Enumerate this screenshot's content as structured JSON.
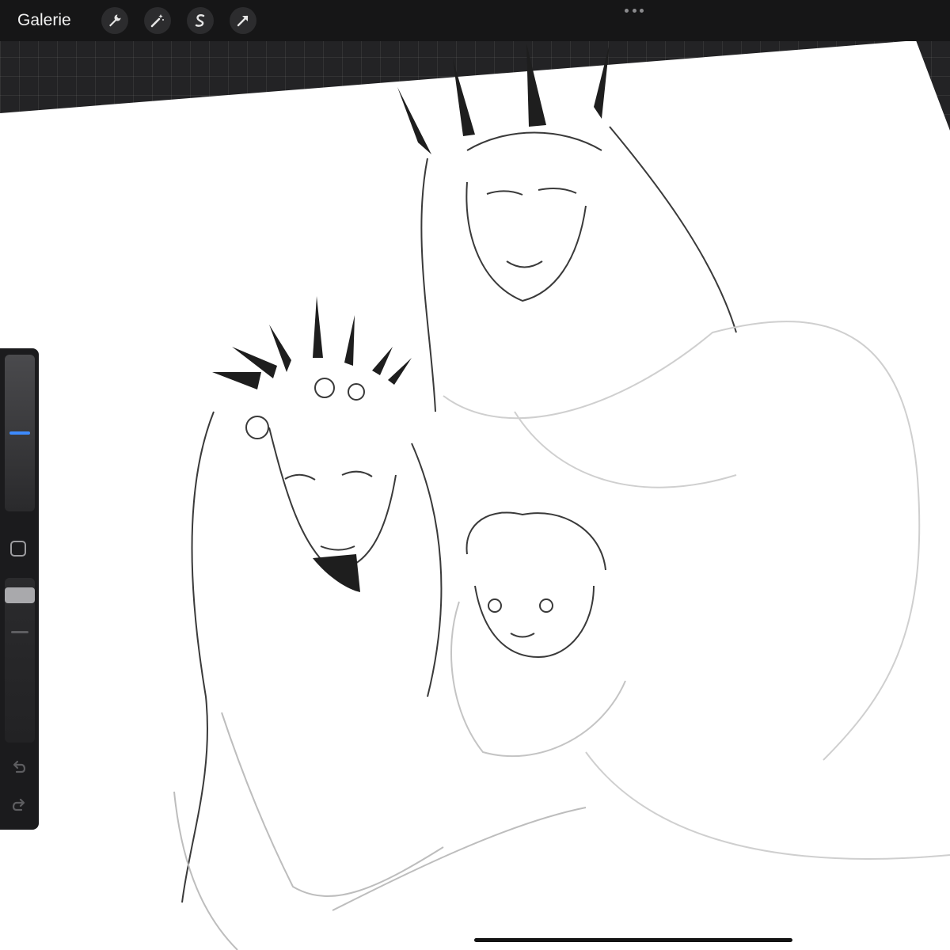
{
  "toolbar": {
    "gallery_label": "Galerie",
    "tools": [
      {
        "name": "actions",
        "icon": "wrench-icon"
      },
      {
        "name": "adjustments",
        "icon": "magic-wand-icon"
      },
      {
        "name": "selection",
        "icon": "selection-s-icon"
      },
      {
        "name": "transform",
        "icon": "arrow-cursor-icon"
      }
    ],
    "more_icon": "ellipsis-icon"
  },
  "sidebar": {
    "brush_size_level": 0.5,
    "brush_opacity_level": 0.95,
    "modify_icon": "square-icon",
    "undo_icon": "undo-arrow-icon",
    "redo_icon": "redo-arrow-icon"
  },
  "canvas": {
    "background_color": "#ffffff",
    "artwork": "pencil-sketch"
  },
  "colors": {
    "ui_background": "#232325",
    "toolbar": "#161617",
    "accent": "#3d8bff"
  }
}
